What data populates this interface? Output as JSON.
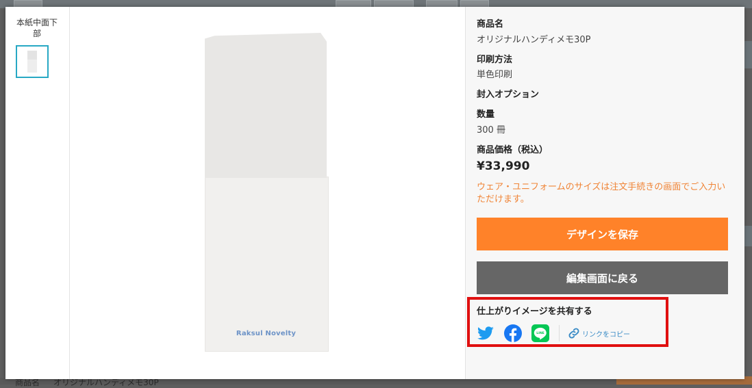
{
  "background": {
    "bottom_label": "商品名",
    "bottom_value": "オリジナルハンディメモ30P"
  },
  "thumbnail": {
    "title": "本紙中面下部"
  },
  "preview": {
    "logo_text": "Raksul Novelty"
  },
  "info": {
    "product_name_label": "商品名",
    "product_name_value": "オリジナルハンディメモ30P",
    "print_method_label": "印刷方法",
    "print_method_value": "単色印刷",
    "option_label": "封入オプション",
    "quantity_label": "数量",
    "quantity_value": "300 冊",
    "price_label": "商品価格（税込）",
    "price_value": "¥33,990",
    "note": "ウェア・ユニフォームのサイズは注文手続きの画面でご入力いただけます。",
    "save_button": "デザインを保存",
    "back_button": "編集画面に戻る"
  },
  "share": {
    "title": "仕上がりイメージを共有する",
    "icons": [
      "twitter-icon",
      "facebook-icon",
      "line-icon"
    ],
    "copy_link_label": "リンクをコピー"
  },
  "colors": {
    "accent_orange": "#ff8229",
    "button_gray": "#666666",
    "selected_border": "#27a8c4",
    "note_orange": "#f08436",
    "highlight_red": "#e01010",
    "twitter_blue": "#1d9bf0",
    "facebook_blue": "#1877f2",
    "line_green": "#06c755"
  }
}
